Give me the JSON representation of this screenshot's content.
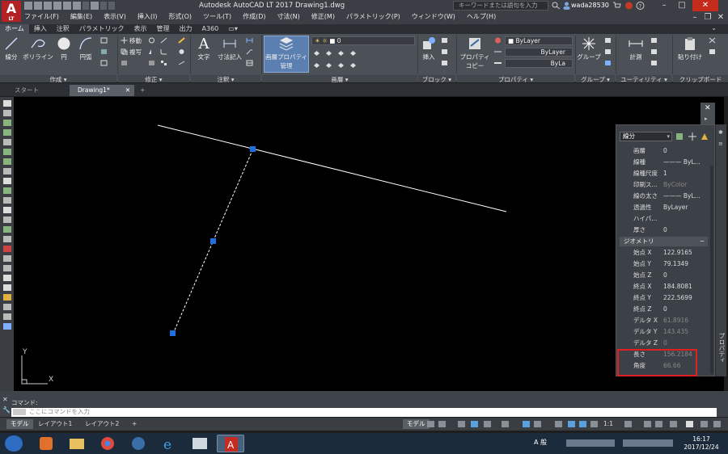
{
  "titlebar": {
    "app_letter": "A",
    "app_sub": "LT",
    "title": "Autodesk AutoCAD LT 2017    Drawing1.dwg",
    "search_placeholder": "キーワードまたは語句を入力",
    "user": "wada28530"
  },
  "menu": [
    "ファイル(F)",
    "編集(E)",
    "表示(V)",
    "挿入(I)",
    "形式(O)",
    "ツール(T)",
    "作成(D)",
    "寸法(N)",
    "修正(M)",
    "パラメトリック(P)",
    "ウィンドウ(W)",
    "ヘルプ(H)"
  ],
  "ribbon_tabs": [
    "ホーム",
    "挿入",
    "注釈",
    "パラメトリック",
    "表示",
    "管理",
    "出力",
    "A360"
  ],
  "ribbon": {
    "draw": {
      "line": "線分",
      "polyline": "ポリライン",
      "circle": "円",
      "arc": "円弧",
      "panel": "作成 ▾"
    },
    "modify": {
      "move": "移動",
      "copy": "複写",
      "panel": "修正 ▾"
    },
    "annotation": {
      "text": "文字",
      "dim": "寸法記入",
      "panel": "注釈 ▾"
    },
    "layers": {
      "manager_line1": "画層プロパティ",
      "manager_line2": "管理",
      "current": "0",
      "panel": "画層 ▾"
    },
    "block": {
      "insert": "挿入",
      "panel": "ブロック ▾"
    },
    "properties": {
      "match_line1": "プロパティ",
      "match_line2": "コピー",
      "color": "ByLayer",
      "linetype": "ByLayer",
      "lineweight": "ByLa",
      "panel": "プロパティ ▾"
    },
    "groups": {
      "group": "グループ",
      "panel": "グループ ▾"
    },
    "utilities": {
      "measure": "計測",
      "panel": "ユーティリティ ▾"
    },
    "clipboard": {
      "paste": "貼り付け",
      "panel": "クリップボード"
    }
  },
  "doc_tabs": {
    "start": "スタート",
    "drawing": "Drawing1*"
  },
  "ucs": {
    "x": "X",
    "y": "Y"
  },
  "properties_palette": {
    "object_type": "線分",
    "general_rows": [
      {
        "k": "画層",
        "v": "0"
      },
      {
        "k": "線種",
        "v": "——— ByL..."
      },
      {
        "k": "線種尺度",
        "v": "1"
      },
      {
        "k": "印刷ス...",
        "v": "ByColor",
        "dim": true
      },
      {
        "k": "線の太さ",
        "v": "——— ByL..."
      },
      {
        "k": "透過性",
        "v": "ByLayer"
      },
      {
        "k": "ハイパ...",
        "v": ""
      },
      {
        "k": "厚さ",
        "v": "0"
      }
    ],
    "geometry_title": "ジオメトリ",
    "geometry_rows": [
      {
        "k": "始点 X",
        "v": "122.9165"
      },
      {
        "k": "始点 Y",
        "v": "79.1349"
      },
      {
        "k": "始点 Z",
        "v": "0"
      },
      {
        "k": "終点 X",
        "v": "184.8081"
      },
      {
        "k": "終点 Y",
        "v": "222.5699"
      },
      {
        "k": "終点 Z",
        "v": "0"
      },
      {
        "k": "デルタ X",
        "v": "61.8916",
        "dim": true
      },
      {
        "k": "デルタ Y",
        "v": "143.435",
        "dim": true
      },
      {
        "k": "デルタ Z",
        "v": "0",
        "dim": true
      },
      {
        "k": "長さ",
        "v": "156.2184",
        "dim": true
      },
      {
        "k": "角度",
        "v": "66.66",
        "dim": true
      }
    ],
    "side_label": "プロパティ"
  },
  "command": {
    "history": "コマンド:",
    "placeholder": "ここにコマンドを入力"
  },
  "layout_tabs": [
    "モデル",
    "レイアウト1",
    "レイアウト2"
  ],
  "status": {
    "model": "モデル",
    "scale": "1:1"
  },
  "taskbar": {
    "time": "16:17",
    "date": "2017/12/24",
    "ime": "A 般"
  },
  "colors": {
    "accent": "#2d6cc0",
    "grip": "#1f6fe0",
    "highlight": "#e02020"
  }
}
